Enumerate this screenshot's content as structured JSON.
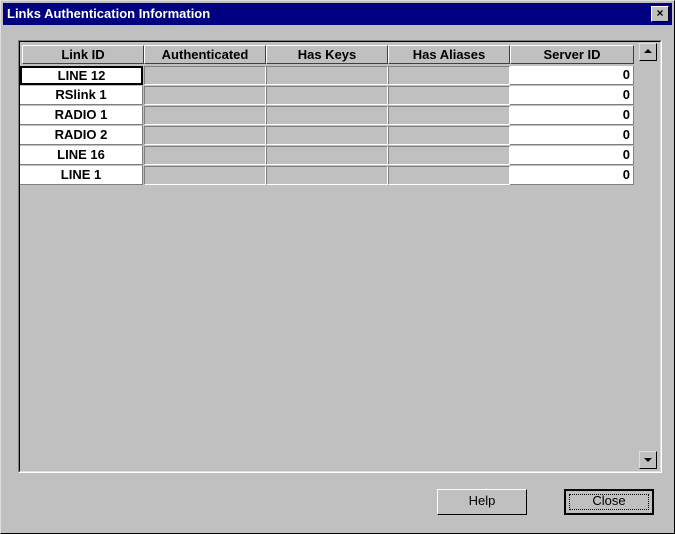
{
  "window": {
    "title": "Links Authentication Information",
    "close_glyph": "×"
  },
  "table": {
    "columns": [
      "Link ID",
      "Authenticated",
      "Has Keys",
      "Has Aliases",
      "Server ID"
    ],
    "rows": [
      {
        "link_id": "LINE 12",
        "authenticated": "",
        "has_keys": "",
        "has_aliases": "",
        "server_id": "0"
      },
      {
        "link_id": "RSlink 1",
        "authenticated": "",
        "has_keys": "",
        "has_aliases": "",
        "server_id": "0"
      },
      {
        "link_id": "RADIO 1",
        "authenticated": "",
        "has_keys": "",
        "has_aliases": "",
        "server_id": "0"
      },
      {
        "link_id": "RADIO 2",
        "authenticated": "",
        "has_keys": "",
        "has_aliases": "",
        "server_id": "0"
      },
      {
        "link_id": "LINE 16",
        "authenticated": "",
        "has_keys": "",
        "has_aliases": "",
        "server_id": "0"
      },
      {
        "link_id": "LINE 1",
        "authenticated": "",
        "has_keys": "",
        "has_aliases": "",
        "server_id": "0"
      }
    ],
    "selected_row": 0
  },
  "buttons": {
    "help": "Help",
    "close": "Close"
  },
  "colors": {
    "titlebar": "#000080",
    "face": "#c0c0c0",
    "cell": "#ffffff"
  },
  "icons": {
    "close": "close-icon",
    "scroll_up": "arrow-up-icon",
    "scroll_down": "arrow-down-icon"
  }
}
